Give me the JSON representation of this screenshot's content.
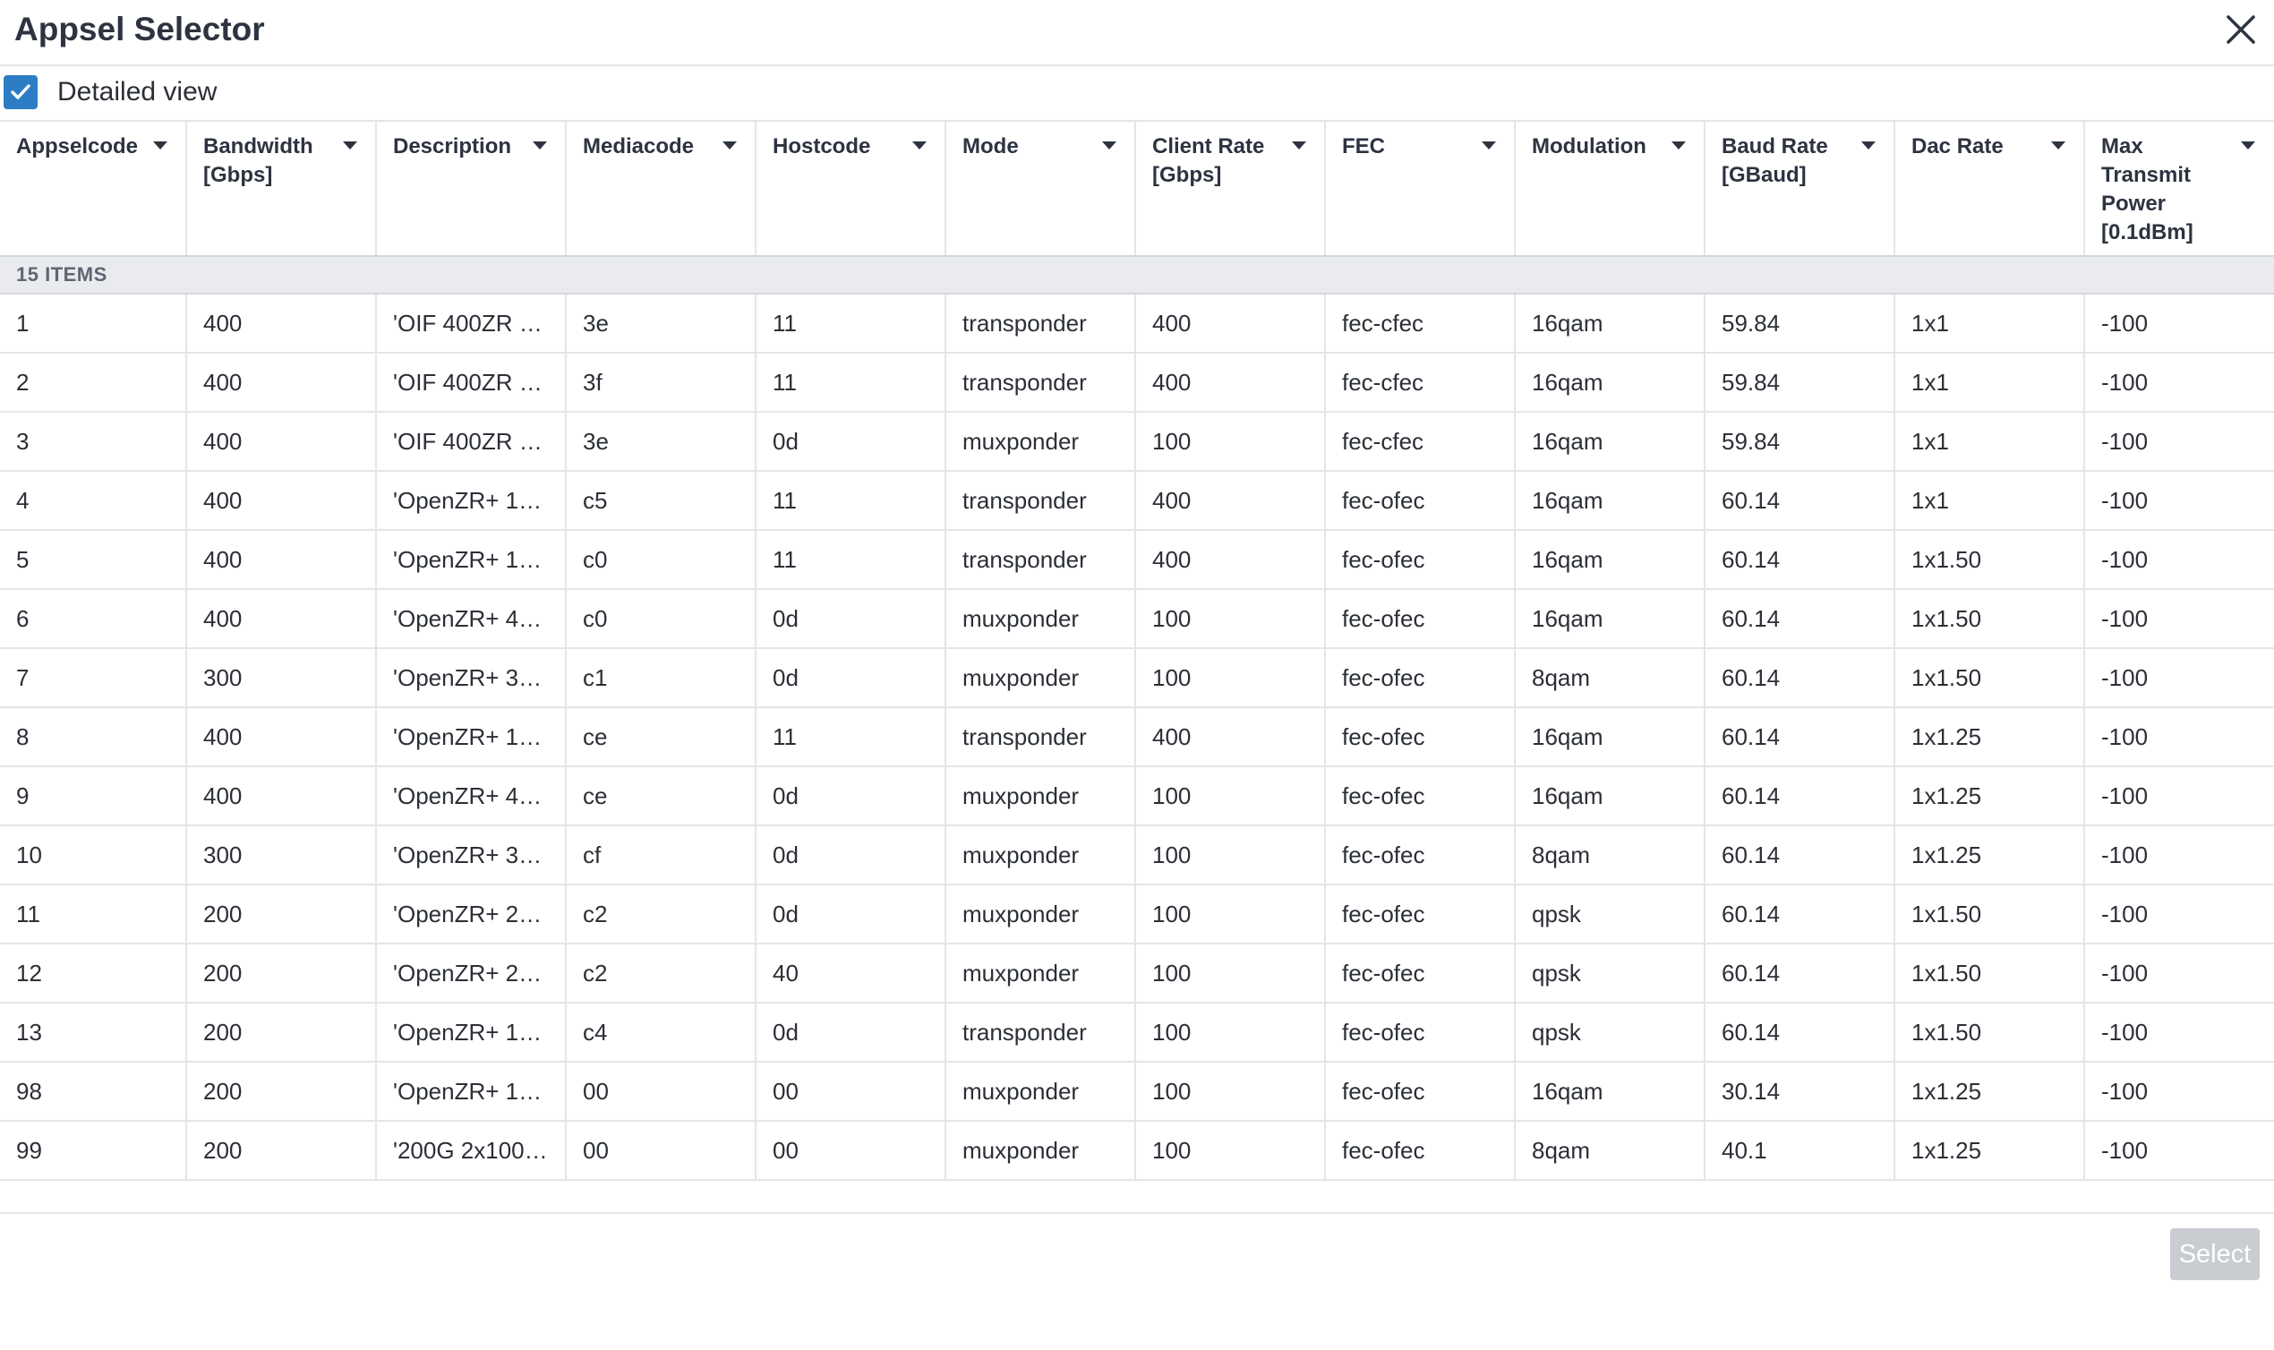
{
  "dialog": {
    "title": "Appsel Selector",
    "detailed_view_label": "Detailed view",
    "detailed_view_checked": true,
    "select_label": "Select",
    "select_enabled": false
  },
  "colors": {
    "checkbox": "#2d7dc4",
    "group_row_bg": "#e9ebee",
    "button_disabled_bg": "#c9ccd1",
    "border": "#e3e5e9"
  },
  "table": {
    "columns": [
      {
        "label": "Appselcode"
      },
      {
        "label": "Bandwidth [Gbps]"
      },
      {
        "label": "Description"
      },
      {
        "label": "Mediacode"
      },
      {
        "label": "Hostcode"
      },
      {
        "label": "Mode"
      },
      {
        "label": "Client Rate [Gbps]"
      },
      {
        "label": "FEC"
      },
      {
        "label": "Modulation"
      },
      {
        "label": "Baud Rate [GBaud]"
      },
      {
        "label": "Dac Rate"
      },
      {
        "label": "Max Transmit Power [0.1dBm]"
      }
    ],
    "group_label": "15 ITEMS",
    "rows": [
      [
        "1",
        "400",
        "'OIF 400ZR 1…",
        "3e",
        "11",
        "transponder",
        "400",
        "fec-cfec",
        "16qam",
        "59.84",
        "1x1",
        "-100"
      ],
      [
        "2",
        "400",
        "'OIF 400ZR 1…",
        "3f",
        "11",
        "transponder",
        "400",
        "fec-cfec",
        "16qam",
        "59.84",
        "1x1",
        "-100"
      ],
      [
        "3",
        "400",
        "'OIF 400ZR 4…",
        "3e",
        "0d",
        "muxponder",
        "100",
        "fec-cfec",
        "16qam",
        "59.84",
        "1x1",
        "-100"
      ],
      [
        "4",
        "400",
        "'OpenZR+ 1x…",
        "c5",
        "11",
        "transponder",
        "400",
        "fec-ofec",
        "16qam",
        "60.14",
        "1x1",
        "-100"
      ],
      [
        "5",
        "400",
        "'OpenZR+ 1x…",
        "c0",
        "11",
        "transponder",
        "400",
        "fec-ofec",
        "16qam",
        "60.14",
        "1x1.50",
        "-100"
      ],
      [
        "6",
        "400",
        "'OpenZR+ 4x…",
        "c0",
        "0d",
        "muxponder",
        "100",
        "fec-ofec",
        "16qam",
        "60.14",
        "1x1.50",
        "-100"
      ],
      [
        "7",
        "300",
        "'OpenZR+ 3x…",
        "c1",
        "0d",
        "muxponder",
        "100",
        "fec-ofec",
        "8qam",
        "60.14",
        "1x1.50",
        "-100"
      ],
      [
        "8",
        "400",
        "'OpenZR+ 1x…",
        "ce",
        "11",
        "transponder",
        "400",
        "fec-ofec",
        "16qam",
        "60.14",
        "1x1.25",
        "-100"
      ],
      [
        "9",
        "400",
        "'OpenZR+ 4x…",
        "ce",
        "0d",
        "muxponder",
        "100",
        "fec-ofec",
        "16qam",
        "60.14",
        "1x1.25",
        "-100"
      ],
      [
        "10",
        "300",
        "'OpenZR+ 3x…",
        "cf",
        "0d",
        "muxponder",
        "100",
        "fec-ofec",
        "8qam",
        "60.14",
        "1x1.25",
        "-100"
      ],
      [
        "11",
        "200",
        "'OpenZR+ 2x…",
        "c2",
        "0d",
        "muxponder",
        "100",
        "fec-ofec",
        "qpsk",
        "60.14",
        "1x1.50",
        "-100"
      ],
      [
        "12",
        "200",
        "'OpenZR+ 2x…",
        "c2",
        "40",
        "muxponder",
        "100",
        "fec-ofec",
        "qpsk",
        "60.14",
        "1x1.50",
        "-100"
      ],
      [
        "13",
        "200",
        "'OpenZR+ 1x…",
        "c4",
        "0d",
        "transponder",
        "100",
        "fec-ofec",
        "qpsk",
        "60.14",
        "1x1.50",
        "-100"
      ],
      [
        "98",
        "200",
        "'OpenZR+ 1x…",
        "00",
        "00",
        "muxponder",
        "100",
        "fec-ofec",
        "16qam",
        "30.14",
        "1x1.25",
        "-100"
      ],
      [
        "99",
        "200",
        "'200G 2x100…",
        "00",
        "00",
        "muxponder",
        "100",
        "fec-ofec",
        "8qam",
        "40.1",
        "1x1.25",
        "-100"
      ]
    ]
  }
}
